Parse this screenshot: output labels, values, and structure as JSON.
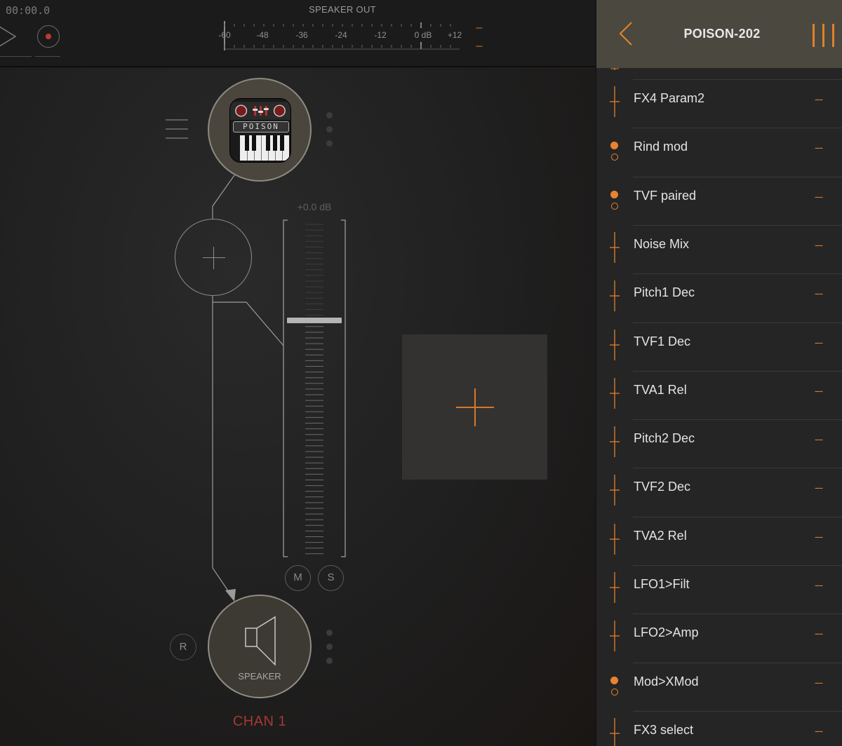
{
  "transport": {
    "time": "00:00.0"
  },
  "meter": {
    "title": "SPEAKER OUT",
    "labels": [
      "-60",
      "-48",
      "-36",
      "-24",
      "-12",
      "0 dB",
      "+12"
    ],
    "peak_left": "---",
    "peak_right": "---"
  },
  "channel": {
    "instrument_logo_text": "POISON",
    "gain_readout": "+0.0 dB",
    "fader_level_db": 0.0,
    "mute_label": "M",
    "solo_label": "S",
    "record_label": "R",
    "output_label": "SPEAKER",
    "name": "CHAN 1"
  },
  "colors": {
    "accent": "#e0812a",
    "channel_name": "#a23a32",
    "record_dot": "#c0392b"
  },
  "panel": {
    "title": "POISON-202",
    "params": [
      {
        "name": "FX4 Param2",
        "value": "---",
        "kind": "slider"
      },
      {
        "name": "Rind mod",
        "value": "---",
        "kind": "toggle"
      },
      {
        "name": "TVF paired",
        "value": "---",
        "kind": "toggle"
      },
      {
        "name": "Noise Mix",
        "value": "---",
        "kind": "slider"
      },
      {
        "name": "Pitch1 Dec",
        "value": "---",
        "kind": "slider"
      },
      {
        "name": "TVF1 Dec",
        "value": "---",
        "kind": "slider"
      },
      {
        "name": "TVA1 Rel",
        "value": "---",
        "kind": "slider"
      },
      {
        "name": "Pitch2 Dec",
        "value": "---",
        "kind": "slider"
      },
      {
        "name": "TVF2 Dec",
        "value": "---",
        "kind": "slider"
      },
      {
        "name": "TVA2 Rel",
        "value": "---",
        "kind": "slider"
      },
      {
        "name": "LFO1>Filt",
        "value": "---",
        "kind": "slider"
      },
      {
        "name": "LFO2>Amp",
        "value": "---",
        "kind": "slider"
      },
      {
        "name": "Mod>XMod",
        "value": "---",
        "kind": "toggle"
      },
      {
        "name": "FX3 select",
        "value": "---",
        "kind": "slider"
      }
    ]
  }
}
